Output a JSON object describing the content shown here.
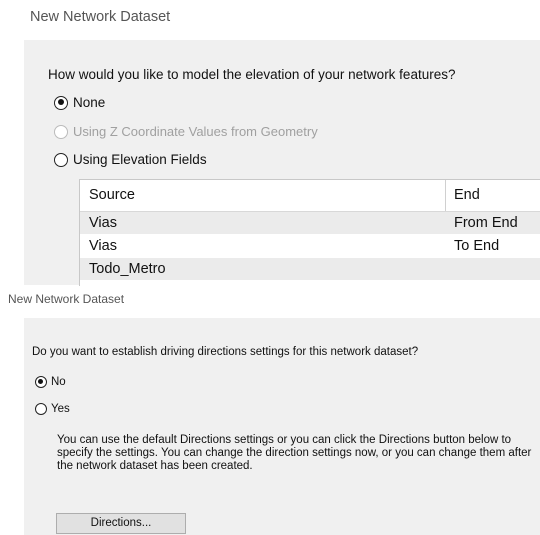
{
  "dialog1": {
    "title": "New Network Dataset",
    "question": "How would you like to model the elevation of your network features?",
    "options": [
      {
        "label": "None",
        "checked": true,
        "disabled": false
      },
      {
        "label": "Using Z Coordinate Values from Geometry",
        "checked": false,
        "disabled": true
      },
      {
        "label": "Using Elevation Fields",
        "checked": false,
        "disabled": false
      }
    ],
    "table": {
      "columns": [
        "Source",
        "End"
      ],
      "rows": [
        [
          "Vias",
          "From End"
        ],
        [
          "Vias",
          "To End"
        ],
        [
          "Todo_Metro",
          ""
        ]
      ]
    }
  },
  "dialog2": {
    "title": "New Network Dataset",
    "question": "Do you want to establish driving directions settings for this network dataset?",
    "options": [
      {
        "label": "No",
        "checked": true
      },
      {
        "label": "Yes",
        "checked": false
      }
    ],
    "info": "You can use the default Directions settings or you can click the Directions button below to specify the settings. You can change the direction settings now, or you can change them after the network dataset has been created.",
    "directions_button": "Directions..."
  }
}
